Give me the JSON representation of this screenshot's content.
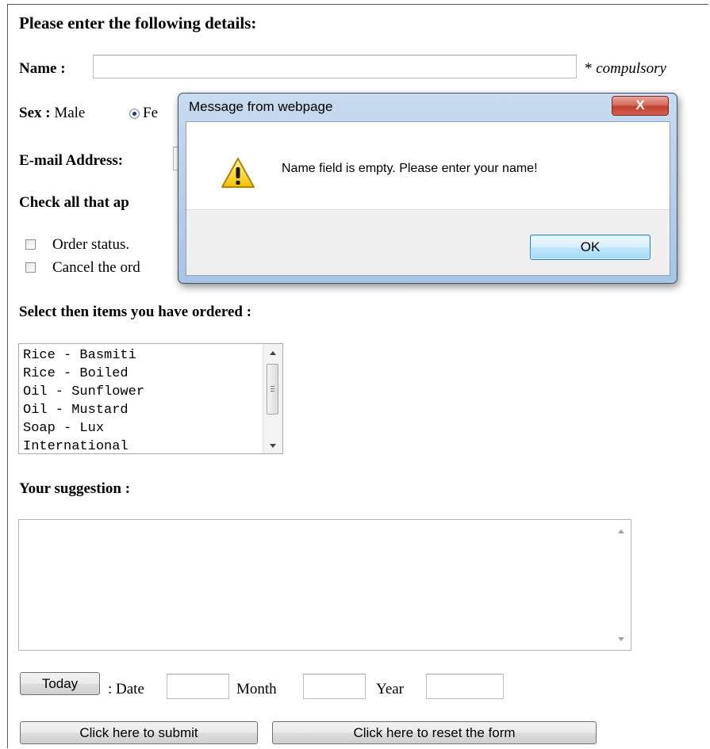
{
  "form": {
    "heading": "Please enter the following details:",
    "name_label": "Name :",
    "name_value": "",
    "compulsory_star": "*",
    "compulsory_text": "compulsory",
    "sex_label": "Sex :",
    "sex_male": "Male",
    "sex_female_partial": "Fe",
    "sex_selected": "Male",
    "email_label": "E-mail Address:",
    "check_heading_partial": "Check all that ap",
    "checkboxes": [
      {
        "label": "Order status.",
        "checked": false
      },
      {
        "label": "Cancel the ord",
        "checked": false
      }
    ],
    "select_heading": "Select then items you have ordered :",
    "items": [
      "Rice - Basmiti",
      "Rice - Boiled",
      "Oil - Sunflower",
      "Oil - Mustard",
      "Soap - Lux",
      "International"
    ],
    "suggestion_label": "Your suggestion :",
    "suggestion_value": "",
    "today_button": "Today",
    "date_label": ": Date",
    "month_label": "Month",
    "year_label": "Year",
    "submit_button": "Click here to submit",
    "reset_button": "Click here to reset the form"
  },
  "dialog": {
    "title": "Message from webpage",
    "close_glyph": "X",
    "message": "Name field is empty. Please enter your name!",
    "ok_button": "OK",
    "icon": "warning-icon"
  }
}
